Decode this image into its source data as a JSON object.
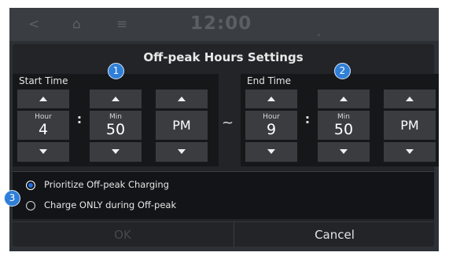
{
  "status_bar": {
    "back_glyph": "<",
    "home_glyph": "⌂",
    "menu_glyph": "≡",
    "clock": "12:00"
  },
  "dialog": {
    "title": "Off-peak Hours Settings",
    "start": {
      "label": "Start Time",
      "hour_unit": "Hour",
      "hour_value": "4",
      "min_unit": "Min",
      "min_value": "50",
      "ampm": "PM"
    },
    "separator": ":",
    "range_glyph": "~",
    "end": {
      "label": "End Time",
      "hour_unit": "Hour",
      "hour_value": "9",
      "min_unit": "Min",
      "min_value": "50",
      "ampm": "PM"
    },
    "options": [
      {
        "label": "Prioritize Off-peak Charging",
        "selected": true
      },
      {
        "label": "Charge ONLY during Off-peak",
        "selected": false
      }
    ],
    "ok_label": "OK",
    "cancel_label": "Cancel"
  },
  "callouts": [
    "1",
    "2",
    "3"
  ],
  "colors": {
    "accent": "#2f7fd8",
    "background": "#222427",
    "panel": "#161719"
  }
}
